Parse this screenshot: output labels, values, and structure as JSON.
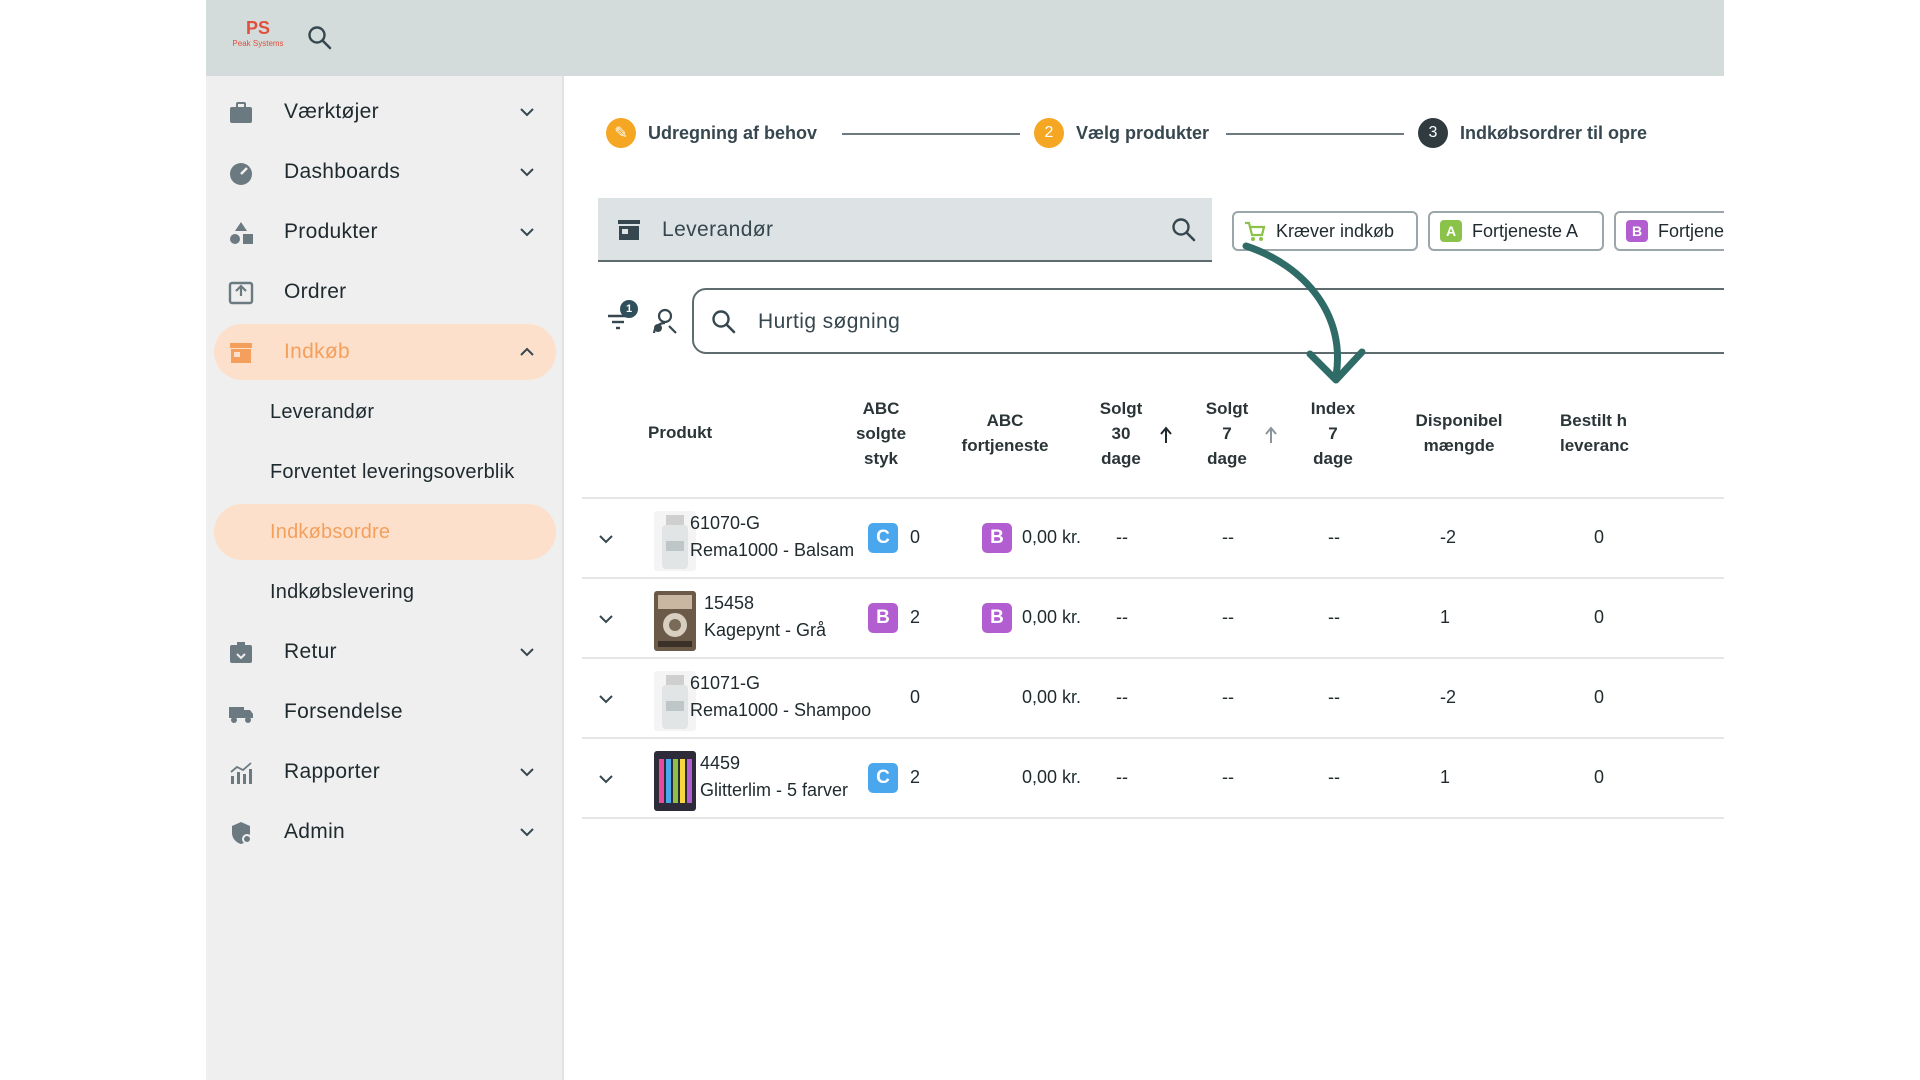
{
  "brand": {
    "logo_mark": "PS",
    "logo_text": "Peak Systems"
  },
  "sidebar": {
    "items": [
      {
        "label": "Værktøjer",
        "icon": "toolbox-icon",
        "expandable": true
      },
      {
        "label": "Dashboards",
        "icon": "gauge-icon",
        "expandable": true
      },
      {
        "label": "Produkter",
        "icon": "shapes-icon",
        "expandable": true
      },
      {
        "label": "Ordrer",
        "icon": "inbox-icon",
        "expandable": false
      },
      {
        "label": "Indkøb",
        "icon": "store-icon",
        "expandable": true,
        "active": true
      },
      {
        "label": "Retur",
        "icon": "return-box-icon",
        "expandable": true
      },
      {
        "label": "Forsendelse",
        "icon": "truck-icon",
        "expandable": false
      },
      {
        "label": "Rapporter",
        "icon": "chart-icon",
        "expandable": true
      },
      {
        "label": "Admin",
        "icon": "admin-shield-icon",
        "expandable": true
      }
    ],
    "sub_items": [
      {
        "label": "Leverandør"
      },
      {
        "label": "Forventet leveringsoverblik"
      },
      {
        "label": "Indkøbsordre",
        "active": true
      },
      {
        "label": "Indkøbslevering"
      }
    ]
  },
  "stepper": {
    "steps": [
      {
        "number": "✎",
        "label": "Udregning af behov",
        "state": "done"
      },
      {
        "number": "2",
        "label": "Vælg produkter",
        "state": "current"
      },
      {
        "number": "3",
        "label": "Indkøbsordrer til opre",
        "state": "upcoming"
      }
    ]
  },
  "supplier": {
    "placeholder": "Leverandør"
  },
  "chips": [
    {
      "label": "Kræver indkøb",
      "badge": "",
      "color": "#8bc34a"
    },
    {
      "label": "Fortjeneste A",
      "badge": "A",
      "color": "#8bc34a"
    },
    {
      "label": "Fortjene",
      "badge": "B",
      "color": "#b25ed0"
    }
  ],
  "filter": {
    "count": "1"
  },
  "quick_search": {
    "placeholder": "Hurtig søgning"
  },
  "table": {
    "headers": {
      "produkt": "Produkt",
      "abc_sold_1": "ABC",
      "abc_sold_2": "solgte",
      "abc_sold_3": "styk",
      "abc_profit_1": "ABC",
      "abc_profit_2": "fortjeneste",
      "sold30_1": "Solgt",
      "sold30_2": "30",
      "sold30_3": "dage",
      "sold7_1": "Solgt",
      "sold7_2": "7",
      "sold7_3": "dage",
      "index7_1": "Index",
      "index7_2": "7",
      "index7_3": "dage",
      "available_1": "Disponibel",
      "available_2": "mængde",
      "ordered_1": "Bestilt h",
      "ordered_2": "leveranc"
    },
    "rows": [
      {
        "code": "61070-G",
        "name": "Rema1000 - Balsam",
        "thumb": "bottle",
        "abc_sold": "C",
        "sold_qty": "0",
        "abc_profit": "B",
        "profit": "0,00 kr.",
        "sold30": "--",
        "sold7": "--",
        "index7": "--",
        "available": "-2",
        "ordered": "0"
      },
      {
        "code": "15458",
        "name": "Kagepynt - Grå",
        "thumb": "deco",
        "abc_sold": "B",
        "sold_qty": "2",
        "abc_profit": "B",
        "profit": "0,00 kr.",
        "sold30": "--",
        "sold7": "--",
        "index7": "--",
        "available": "1",
        "ordered": "0"
      },
      {
        "code": "61071-G",
        "name": "Rema1000 - Shampoo",
        "thumb": "bottle",
        "abc_sold": "",
        "sold_qty": "0",
        "abc_profit": "",
        "profit": "0,00 kr.",
        "sold30": "--",
        "sold7": "--",
        "index7": "--",
        "available": "-2",
        "ordered": "0"
      },
      {
        "code": "4459",
        "name": "Glitterlim - 5 farver",
        "thumb": "glitter",
        "abc_sold": "C",
        "sold_qty": "2",
        "abc_profit": "",
        "profit": "0,00 kr.",
        "sold30": "--",
        "sold7": "--",
        "index7": "--",
        "available": "1",
        "ordered": "0"
      }
    ]
  },
  "colors": {
    "accent": "#f4a05c",
    "active_bg": "#fde0cb",
    "topbar": "#d3dcdb",
    "step_done": "#f5a623",
    "step_upcoming": "#2f3b3f",
    "arrow": "#2f6b67"
  }
}
